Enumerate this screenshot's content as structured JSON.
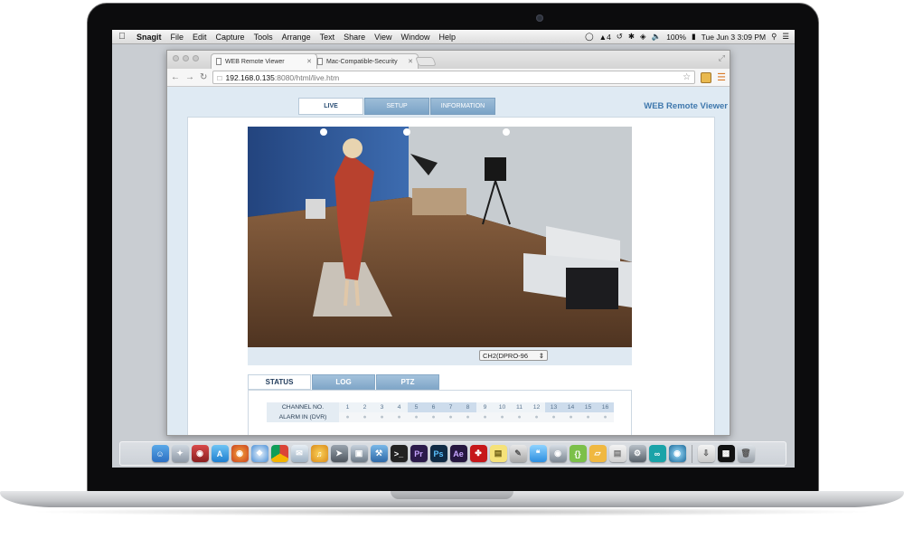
{
  "menubar": {
    "app_name": "Snagit",
    "items": [
      "File",
      "Edit",
      "Capture",
      "Tools",
      "Arrange",
      "Text",
      "Share",
      "View",
      "Window",
      "Help"
    ],
    "status_count": "4",
    "battery": "100%",
    "datetime": "Tue Jun 3  3:09 PM"
  },
  "browser": {
    "tabs": [
      {
        "label": "WEB Remote Viewer",
        "active": true
      },
      {
        "label": "Mac-Compatible-Security",
        "active": false
      }
    ],
    "url_host": "192.168.0.135",
    "url_path": ":8080/html/live.htm"
  },
  "viewer": {
    "brand": "WEB Remote Viewer",
    "nav_tabs": [
      "LIVE",
      "SETUP",
      "INFORMATION"
    ],
    "active_nav": "LIVE",
    "channel_select": "CH2(DPRO-96",
    "status_tabs": [
      "STATUS",
      "LOG",
      "PTZ"
    ],
    "active_status_tab": "STATUS",
    "table": {
      "channel_label": "CHANNEL NO.",
      "alarm_label": "ALARM IN (DVR)",
      "channels": [
        "1",
        "2",
        "3",
        "4",
        "5",
        "6",
        "7",
        "8",
        "9",
        "10",
        "11",
        "12",
        "13",
        "14",
        "15",
        "16"
      ],
      "alarm_values": [
        "",
        "",
        "",
        "",
        "",
        "",
        "",
        "",
        "",
        "",
        "",
        "",
        "",
        "",
        "",
        ""
      ]
    }
  },
  "dock": {
    "icons": [
      "finder-icon",
      "launchpad-icon",
      "photo-booth-icon",
      "app-store-icon",
      "firefox-icon",
      "safari-icon",
      "chrome-icon",
      "mail-icon",
      "itunes-icon",
      "rocket-icon",
      "preview-icon",
      "xcode-icon",
      "terminal-icon",
      "premiere-icon",
      "photoshop-icon",
      "after-effects-icon",
      "acrobat-icon",
      "stickies-icon",
      "scripts-icon",
      "messages-icon",
      "facetime-icon",
      "brackets-icon",
      "sequel-icon",
      "notes-icon",
      "system-prefs-icon",
      "arduino-icon",
      "webcam-icon",
      "downloads-icon",
      "display-icon",
      "trash-icon"
    ]
  },
  "colors": {
    "accent": "#3f78ad",
    "tab_blue": "#7aa3c7",
    "page_bg": "#dfeaf3"
  }
}
